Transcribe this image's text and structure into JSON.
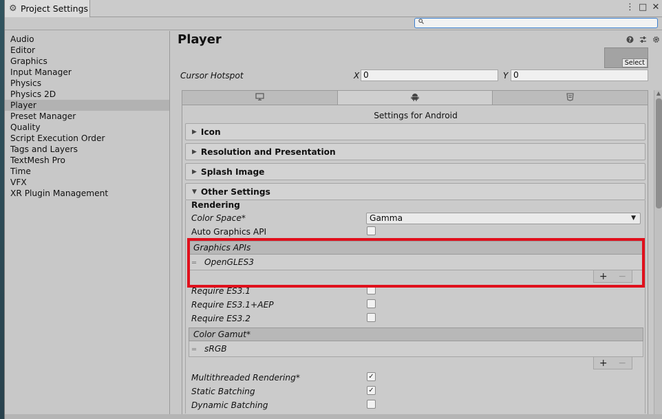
{
  "window": {
    "tab_title": "Project Settings",
    "controls": [
      "⋮",
      "□",
      "✕"
    ]
  },
  "search": {
    "placeholder": "",
    "icon": "search-icon"
  },
  "sidebar": {
    "items": [
      {
        "label": "Audio",
        "selected": false
      },
      {
        "label": "Editor",
        "selected": false
      },
      {
        "label": "Graphics",
        "selected": false
      },
      {
        "label": "Input Manager",
        "selected": false
      },
      {
        "label": "Physics",
        "selected": false
      },
      {
        "label": "Physics 2D",
        "selected": false
      },
      {
        "label": "Player",
        "selected": true
      },
      {
        "label": "Preset Manager",
        "selected": false
      },
      {
        "label": "Quality",
        "selected": false
      },
      {
        "label": "Script Execution Order",
        "selected": false
      },
      {
        "label": "Tags and Layers",
        "selected": false
      },
      {
        "label": "TextMesh Pro",
        "selected": false
      },
      {
        "label": "Time",
        "selected": false
      },
      {
        "label": "VFX",
        "selected": false
      },
      {
        "label": "XR Plugin Management",
        "selected": false
      }
    ]
  },
  "main": {
    "title": "Player",
    "header_icons": [
      "help-icon",
      "preset-icon",
      "gear-icon"
    ],
    "cursor_thumb_select": "Select",
    "cursor_hotspot": {
      "label": "Cursor Hotspot",
      "x_label": "X",
      "x_value": "0",
      "y_label": "Y",
      "y_value": "0"
    },
    "platform_tabs": [
      {
        "name": "standalone",
        "icon": "monitor-icon",
        "active": false
      },
      {
        "name": "android",
        "icon": "android-icon",
        "active": true
      },
      {
        "name": "webgl",
        "icon": "html5-icon",
        "active": false
      }
    ],
    "settings_for": "Settings for Android",
    "foldouts": {
      "icon": "Icon",
      "resolution": "Resolution and Presentation",
      "splash": "Splash Image",
      "other": "Other Settings"
    },
    "rendering": {
      "heading": "Rendering",
      "color_space_label": "Color Space*",
      "color_space_value": "Gamma",
      "auto_graphics_label": "Auto Graphics API",
      "auto_graphics_checked": false,
      "graphics_apis_header": "Graphics APIs",
      "graphics_apis": [
        "OpenGLES3"
      ],
      "require_es31_label": "Require ES3.1",
      "require_es31_aep_label": "Require ES3.1+AEP",
      "require_es32_label": "Require ES3.2",
      "color_gamut_header": "Color Gamut*",
      "color_gamut": [
        "sRGB"
      ],
      "multithreaded_label": "Multithreaded Rendering*",
      "multithreaded_checked": true,
      "static_batching_label": "Static Batching",
      "static_batching_checked": true,
      "dynamic_batching_label": "Dynamic Batching",
      "dynamic_batching_checked": false
    },
    "list_buttons": {
      "plus": "+",
      "minus": "−"
    }
  },
  "colors": {
    "highlight": "#e0101c",
    "search_focus": "#3a7fd0",
    "selected_sidebar": "#b2b2b2"
  }
}
